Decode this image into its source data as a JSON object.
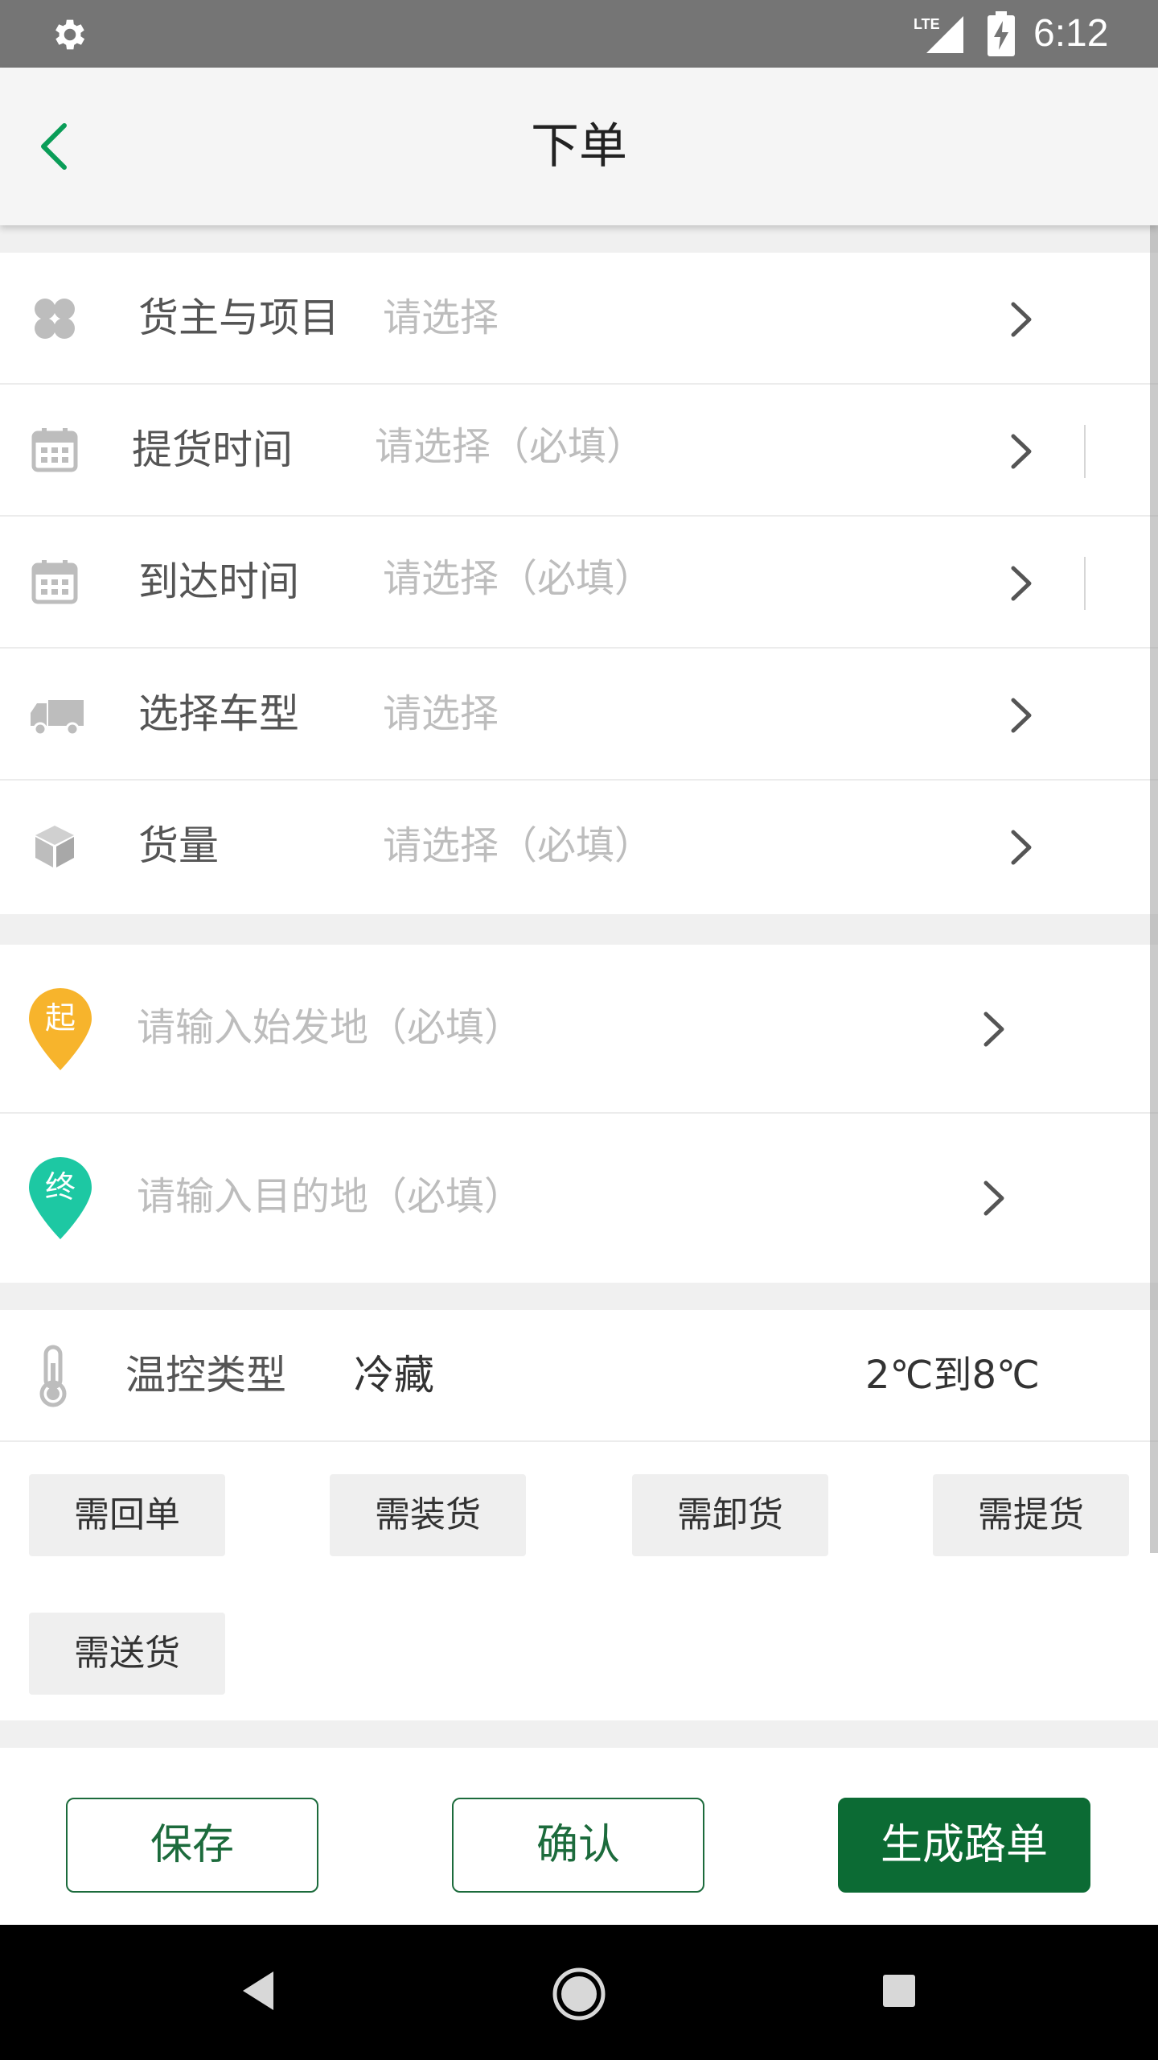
{
  "status_bar": {
    "time": "6:12",
    "network": "LTE",
    "icons": [
      "settings-icon",
      "lte-signal-icon",
      "battery-charging-icon"
    ]
  },
  "header": {
    "title": "下单",
    "back_icon": "back-arrow-icon",
    "accent_color": "#0a9d58"
  },
  "order_fields": [
    {
      "label": "货主与项目",
      "placeholder": "请选择",
      "icon": "grid-icon"
    },
    {
      "label": "提货时间",
      "placeholder": "请选择（必填）",
      "icon": "calendar-icon"
    },
    {
      "label": "到达时间",
      "placeholder": "请选择（必填）",
      "icon": "calendar-icon"
    },
    {
      "label": "选择车型",
      "placeholder": "请选择",
      "icon": "truck-icon"
    },
    {
      "label": "货量",
      "placeholder": "请选择（必填）",
      "icon": "box-icon"
    }
  ],
  "route": {
    "origin": {
      "badge": "起",
      "placeholder": "请输入始发地（必填）",
      "color": "#f7b42c"
    },
    "destination": {
      "badge": "终",
      "placeholder": "请输入目的地（必填）",
      "color": "#1dc8a3"
    }
  },
  "temperature": {
    "label": "温控类型",
    "value": "冷藏",
    "range": "2℃到8℃"
  },
  "service_tags": [
    "需回单",
    "需装货",
    "需卸货",
    "需提货",
    "需送货"
  ],
  "actions": {
    "save": "保存",
    "confirm": "确认",
    "generate": "生成路单",
    "primary_color": "#0c6b34"
  }
}
